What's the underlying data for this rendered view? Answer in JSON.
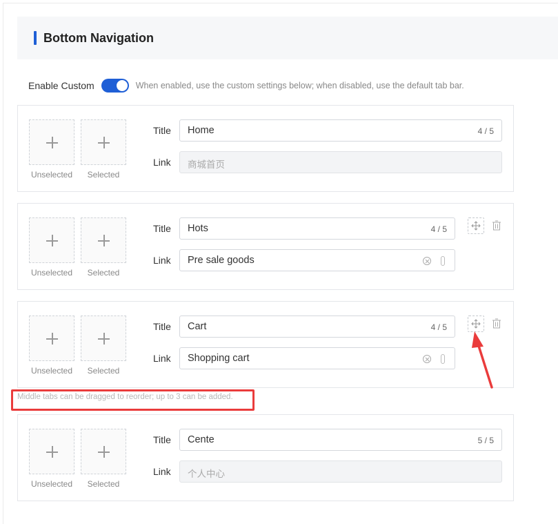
{
  "section": {
    "title": "Bottom Navigation"
  },
  "enable": {
    "label": "Enable Custom",
    "on": true,
    "hint": "When enabled, use the custom settings below; when disabled, use the default tab bar."
  },
  "labels": {
    "unselected": "Unselected",
    "selected": "Selected",
    "title": "Title",
    "link": "Link"
  },
  "tabs": [
    {
      "title": "Home",
      "count": "4 / 5",
      "link": "商城首页",
      "link_disabled": true
    },
    {
      "title": "Hots",
      "count": "4 / 5",
      "link": "Pre sale goods",
      "link_disabled": false
    },
    {
      "title": "Cart",
      "count": "4 / 5",
      "link": "Shopping cart",
      "link_disabled": false
    },
    {
      "title": "Cente",
      "count": "5 / 5",
      "link": "个人中心",
      "link_disabled": true
    }
  ],
  "middle_hint": "Middle tabs can be dragged to reorder; up to 3 can be added.",
  "colors": {
    "accent": "#1f5fd6",
    "annotation": "#ea3c3c"
  }
}
